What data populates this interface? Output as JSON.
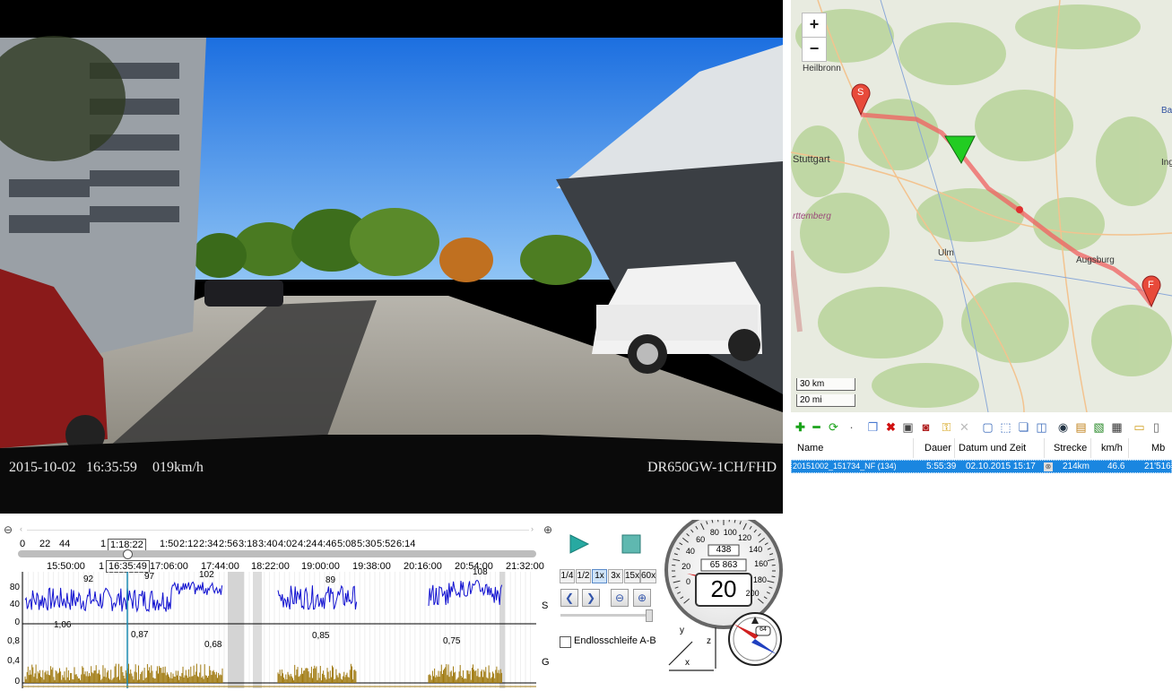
{
  "video": {
    "osd_date": "2015-10-02",
    "osd_time": "16:35:59",
    "osd_speed": "019km/h",
    "osd_model": "DR650GW-1CH/FHD"
  },
  "timeline": {
    "zoom_out_icon": "zoom-out-icon",
    "zoom_in_icon": "zoom-in-icon",
    "top_ticks": [
      "0",
      "22",
      "44",
      "1:18:22",
      "1:50",
      "2:12",
      "2:34",
      "2:56",
      "3:18",
      "3:40",
      "4:02",
      "4:24",
      "4:46",
      "5:08",
      "5:30",
      "5:52",
      "6:14"
    ],
    "top_tick_prefix": "1",
    "clock_ticks": [
      "15:50:00",
      "16:35:49",
      "17:06:00",
      "17:44:00",
      "18:22:00",
      "19:00:00",
      "19:38:00",
      "20:16:00",
      "20:54:00",
      "21:32:00"
    ],
    "clock_prefix": "1",
    "speed_axis": [
      "80",
      "40",
      "0"
    ],
    "g_axis": [
      "0,8",
      "0,4",
      "0"
    ],
    "speed_peaks": [
      "92",
      "97",
      "102",
      "89",
      "108"
    ],
    "g_peaks": [
      "1,06",
      "0,87",
      "0,68",
      "0,85",
      "0,75"
    ],
    "speed_label": "S",
    "g_label": "G"
  },
  "controls": {
    "play_icon": "play-icon",
    "stop_icon": "stop-icon",
    "speeds": [
      "1/4",
      "1/2",
      "1x",
      "3x",
      "15x",
      "60x"
    ],
    "selected_speed": "1x",
    "loop_label": "Endlosschleife A-B",
    "loop_checked": false
  },
  "gauges": {
    "speed": "20",
    "odometer_top": "438",
    "odometer": "65 863",
    "dial_labels": [
      "40",
      "60",
      "80",
      "100",
      "120",
      "140",
      "160",
      "180",
      "200",
      "20",
      "0"
    ],
    "heading": "64",
    "axes": [
      "y",
      "z",
      "x"
    ]
  },
  "map": {
    "zoom_in": "+",
    "zoom_out": "−",
    "cities": [
      "Heilbronn",
      "Stuttgart",
      "rttemberg",
      "Ulm",
      "Augsburg",
      "Ba",
      "Ing"
    ],
    "start_marker": "S",
    "finish_marker": "F",
    "scale_km": "30 km",
    "scale_mi": "20 mi"
  },
  "list": {
    "headers": [
      "Name",
      "Dauer",
      "Datum und Zeit",
      "Strecke",
      "km/h",
      "Mb"
    ],
    "row": {
      "name": "20151002_151734_NF (134)",
      "duration": "5:55:39",
      "datetime": "02.10.2015 15:17",
      "distance": "214km",
      "speed": "46.6",
      "mb": "21'516"
    }
  },
  "chart_data": [
    {
      "type": "area",
      "title": "",
      "series": [
        {
          "name": "S",
          "peaks": [
            92,
            97,
            102,
            89,
            108
          ]
        }
      ],
      "ylim": [
        0,
        110
      ],
      "y_ticks": [
        0,
        40,
        80
      ]
    },
    {
      "type": "area",
      "title": "",
      "series": [
        {
          "name": "G",
          "peaks": [
            1.06,
            0.87,
            0.68,
            0.85,
            0.75
          ]
        }
      ],
      "ylim": [
        0,
        1.1
      ],
      "y_ticks": [
        0,
        0.4,
        0.8
      ]
    }
  ]
}
